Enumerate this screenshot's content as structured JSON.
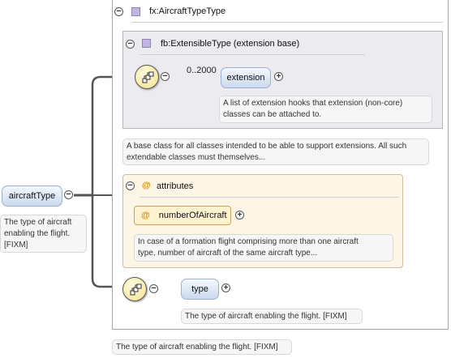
{
  "complex_type": {
    "name": "fx:AircraftTypeType"
  },
  "extension_base": {
    "name": "fb:ExtensibleType (extension base)"
  },
  "extension_element": {
    "occurrence": "0..2000",
    "name": "extension",
    "doc_line1": "A list of extension hooks that extension (non-core)",
    "doc_line2": "classes can be attached to."
  },
  "base_doc": {
    "line1": "A base class for all classes intended to be able to support extensions. All such",
    "line2": "extendable classes must themselves..."
  },
  "attributes": {
    "title": "attributes",
    "at_symbol": "@",
    "attr_name": "numberOfAircraft",
    "doc_line1": "In case of a formation flight comprising more than one aircraft",
    "doc_line2": "type, number of aircraft of the same aircraft type..."
  },
  "type_element": {
    "name": "type",
    "doc": "The type of aircraft enabling the flight. [FIXM]"
  },
  "root_element": {
    "name": "aircraftType",
    "doc_line1": "The type of aircraft",
    "doc_line2": "enabling the flight.",
    "doc_line3": "[FIXM]"
  },
  "outer_doc": "The type of aircraft enabling the flight. [FIXM]",
  "symbols": {
    "minus": "−",
    "plus": "+"
  },
  "icons": [
    "sequence-icon",
    "collapse-icon",
    "expand-icon",
    "complex-type-icon",
    "attribute-icon"
  ],
  "colors": {
    "type_square": "#c2b5e0",
    "element_pill": "#cbd9ee",
    "attribute_group": "#fdf5e6",
    "attribute_marker": "#d58a00",
    "sequence_compositor": "#f2e28c"
  }
}
